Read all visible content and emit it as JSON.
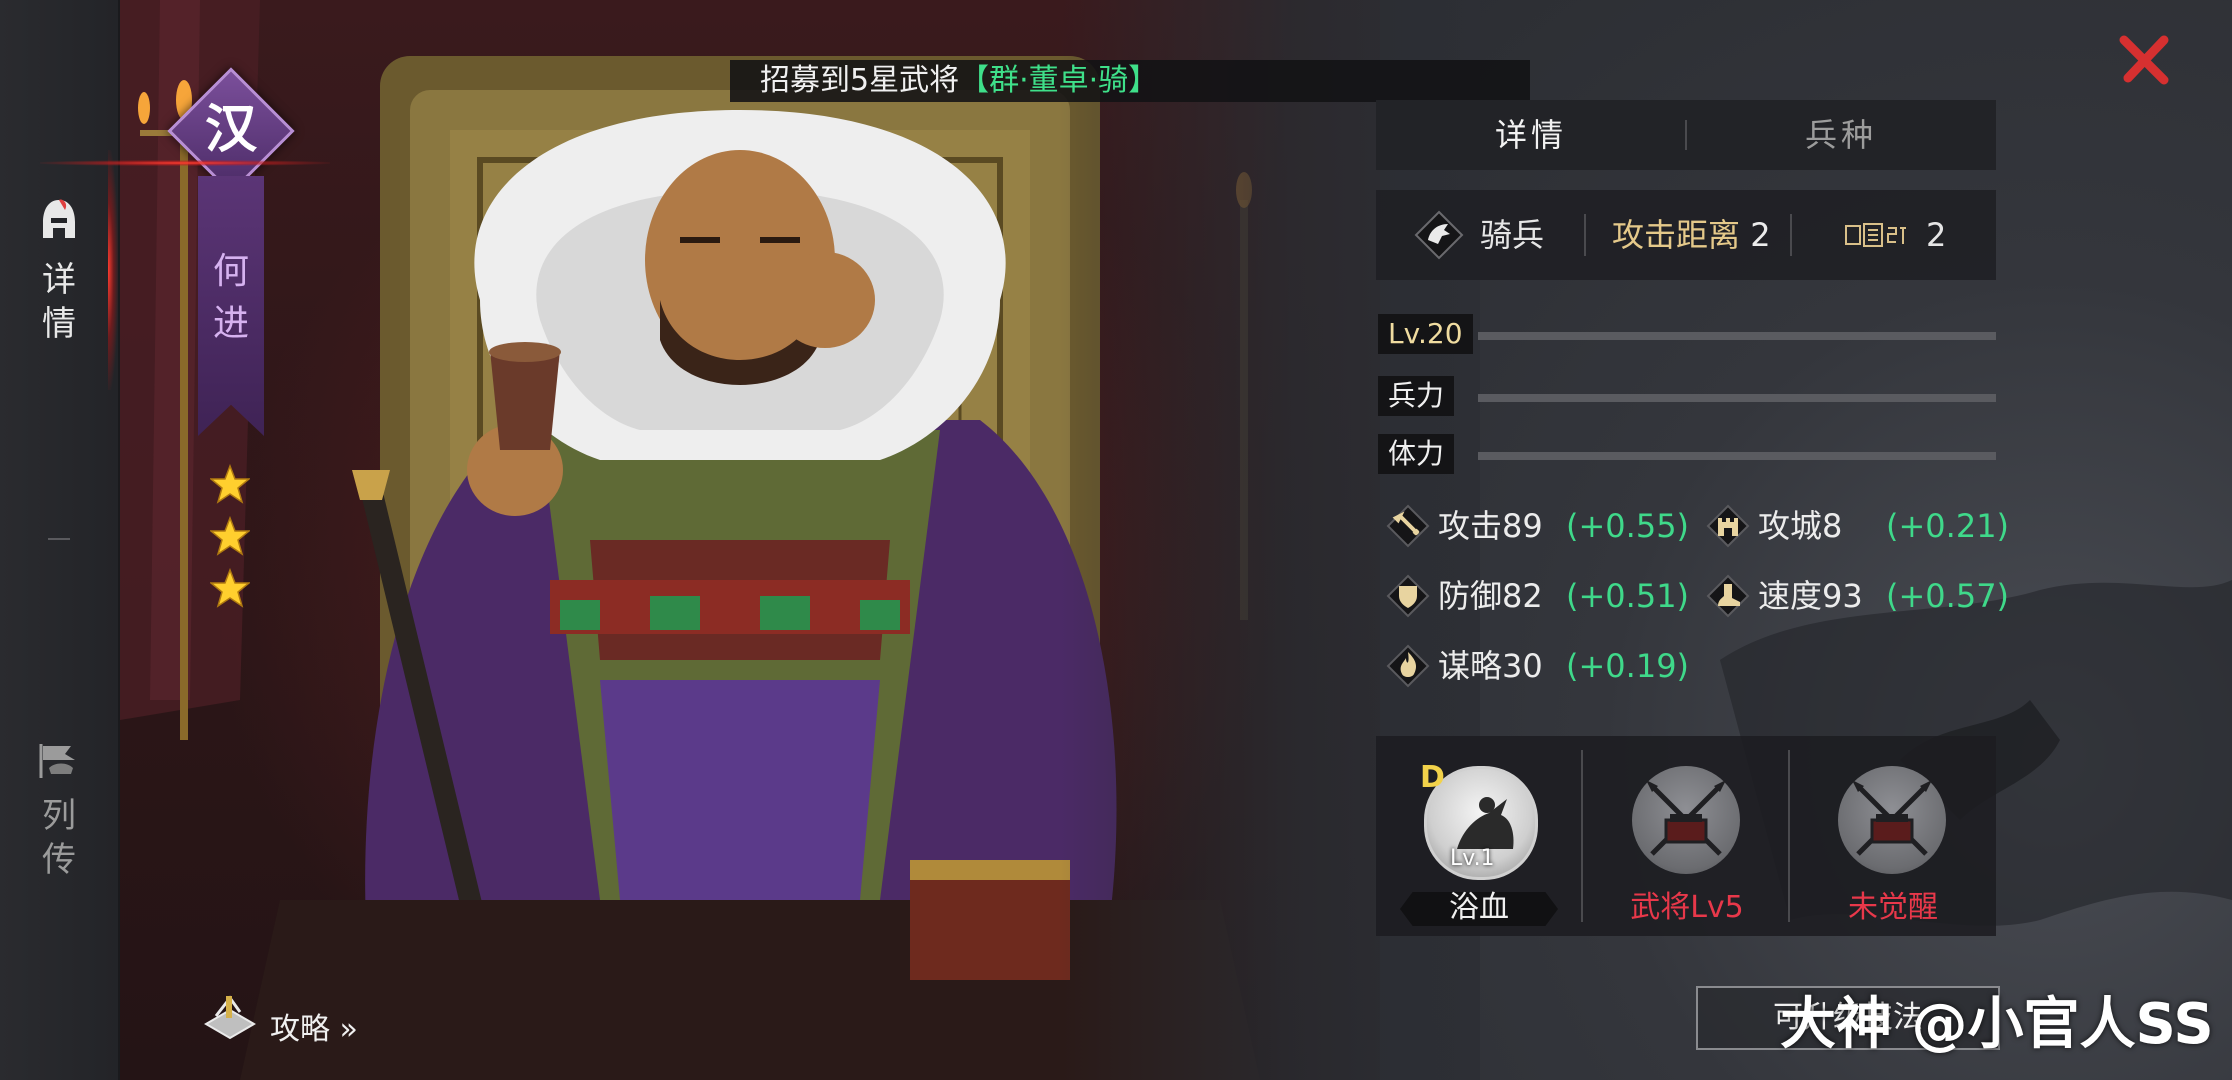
{
  "sidebar": {
    "tabs": [
      {
        "label": "详情",
        "icon": "helmet-icon",
        "active": true
      },
      {
        "label": "列传",
        "icon": "horse-flag-icon",
        "active": false
      }
    ]
  },
  "banner": {
    "prefix": "招募到5星武将",
    "highlight": "【群·董卓·骑】"
  },
  "general": {
    "faction": "汉",
    "name": "何进",
    "stars": 3
  },
  "guide": {
    "label": "攻略 »"
  },
  "panel": {
    "tabs": [
      {
        "label": "详情",
        "active": true
      },
      {
        "label": "兵种",
        "active": false
      }
    ],
    "info": {
      "troop_type": "骑兵",
      "attack_range_label": "攻击距离",
      "attack_range": "2",
      "cost_value": "2"
    },
    "bars": [
      {
        "label": "Lv.20"
      },
      {
        "label": "兵力"
      },
      {
        "label": "体力"
      }
    ],
    "attributes": [
      {
        "name": "攻击89",
        "growth": "(+0.55)",
        "icon": "sword-icon"
      },
      {
        "name": "攻城8",
        "growth": "(+0.21)",
        "icon": "castle-icon"
      },
      {
        "name": "防御82",
        "growth": "(+0.51)",
        "icon": "shield-icon"
      },
      {
        "name": "速度93",
        "growth": "(+0.57)",
        "icon": "boot-icon"
      },
      {
        "name": "谋略30",
        "growth": "(+0.19)",
        "icon": "flame-icon"
      }
    ],
    "skills": [
      {
        "grade": "D",
        "level": "Lv.1",
        "name": "浴血",
        "locked": false
      },
      {
        "name": "武将Lv5",
        "locked": true
      },
      {
        "name": "未觉醒",
        "locked": true
      }
    ]
  },
  "bottom_button": {
    "label": "可升级技法"
  },
  "watermark": "大神 @小官人SS",
  "colors": {
    "growth_green": "#3fd98a",
    "locked_red": "#e8384a",
    "faction_purple": "#5b3576",
    "highlight_green": "#3fe08a"
  }
}
